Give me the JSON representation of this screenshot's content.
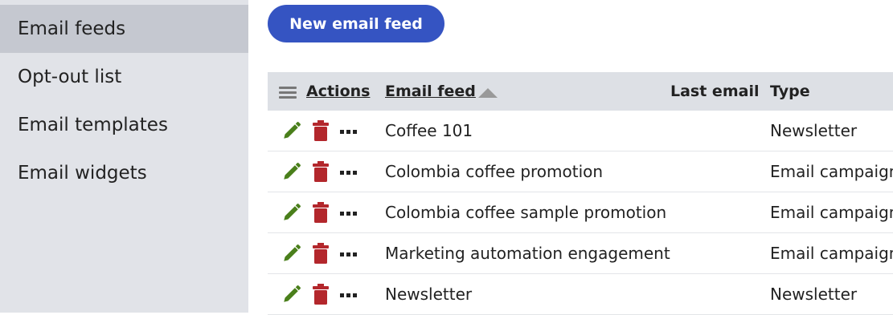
{
  "sidebar": {
    "items": [
      {
        "label": "Email feeds",
        "active": true
      },
      {
        "label": "Opt-out list",
        "active": false
      },
      {
        "label": "Email templates",
        "active": false
      },
      {
        "label": "Email widgets",
        "active": false
      }
    ]
  },
  "toolbar": {
    "new_feed_label": "New email feed"
  },
  "grid": {
    "columns": {
      "actions": "Actions",
      "email_feed": "Email feed",
      "last_email": "Last email",
      "type": "Type"
    },
    "sort": {
      "column": "Email feed",
      "direction": "ascending"
    },
    "rows": [
      {
        "name": "Coffee 101",
        "last_email": "",
        "type": "Newsletter"
      },
      {
        "name": "Colombia coffee promotion",
        "last_email": "",
        "type": "Email campaign"
      },
      {
        "name": "Colombia coffee sample promotion",
        "last_email": "",
        "type": "Email campaign"
      },
      {
        "name": "Marketing automation engagement",
        "last_email": "",
        "type": "Email campaign"
      },
      {
        "name": "Newsletter",
        "last_email": "",
        "type": "Newsletter"
      }
    ]
  },
  "icons": {
    "edit": "pencil-icon",
    "delete": "trash-icon",
    "more": "more-dots-icon",
    "column_menu": "menu-icon",
    "sort": "sort-ascending-icon"
  },
  "colors": {
    "primary_button": "#3554c2",
    "edit_icon": "#4a7f1b",
    "delete_icon": "#b3272c",
    "sidebar_bg": "#e1e3e8",
    "sidebar_active": "#c5c8d0",
    "header_bg": "#dde0e5"
  }
}
